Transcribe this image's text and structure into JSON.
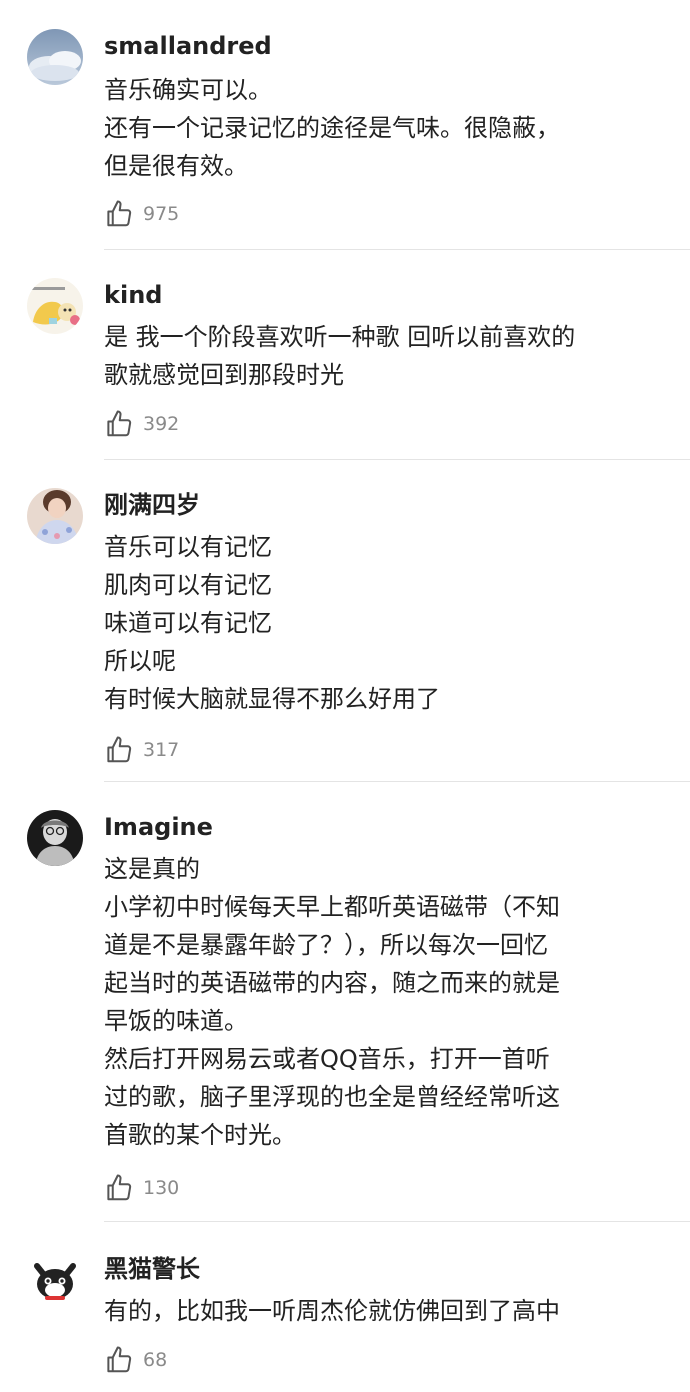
{
  "comments": [
    {
      "username": "smallandred",
      "avatar_icon": "cloud-sky-avatar",
      "lines": [
        "音乐确实可以。",
        "还有一个记录记忆的途径是气味。很隐蔽，",
        "但是很有效。"
      ],
      "likes": "975"
    },
    {
      "username": "kind",
      "avatar_icon": "cartoon-sticker-avatar",
      "lines": [
        "是 我一个阶段喜欢听一种歌 回听以前喜欢的",
        "歌就感觉回到那段时光"
      ],
      "likes": "392"
    },
    {
      "username": "刚满四岁",
      "avatar_icon": "girl-photo-avatar",
      "lines": [
        "音乐可以有记忆",
        "肌肉可以有记忆",
        "味道可以有记忆",
        "所以呢",
        "有时候大脑就显得不那么好用了"
      ],
      "likes": "317"
    },
    {
      "username": "Imagine",
      "avatar_icon": "bw-portrait-avatar",
      "lines": [
        "这是真的",
        "小学初中时候每天早上都听英语磁带（不知",
        "道是不是暴露年龄了？），所以每次一回忆",
        "起当时的英语磁带的内容，随之而来的就是",
        "早饭的味道。",
        "然后打开网易云或者QQ音乐，打开一首听",
        "过的歌，脑子里浮现的也全是曾经经常听这",
        "首歌的某个时光。"
      ],
      "likes": "130"
    },
    {
      "username": "黑猫警长",
      "avatar_icon": "black-cat-avatar",
      "lines": [
        "有的，比如我一听周杰伦就仿佛回到了高中"
      ],
      "likes": "68"
    }
  ]
}
